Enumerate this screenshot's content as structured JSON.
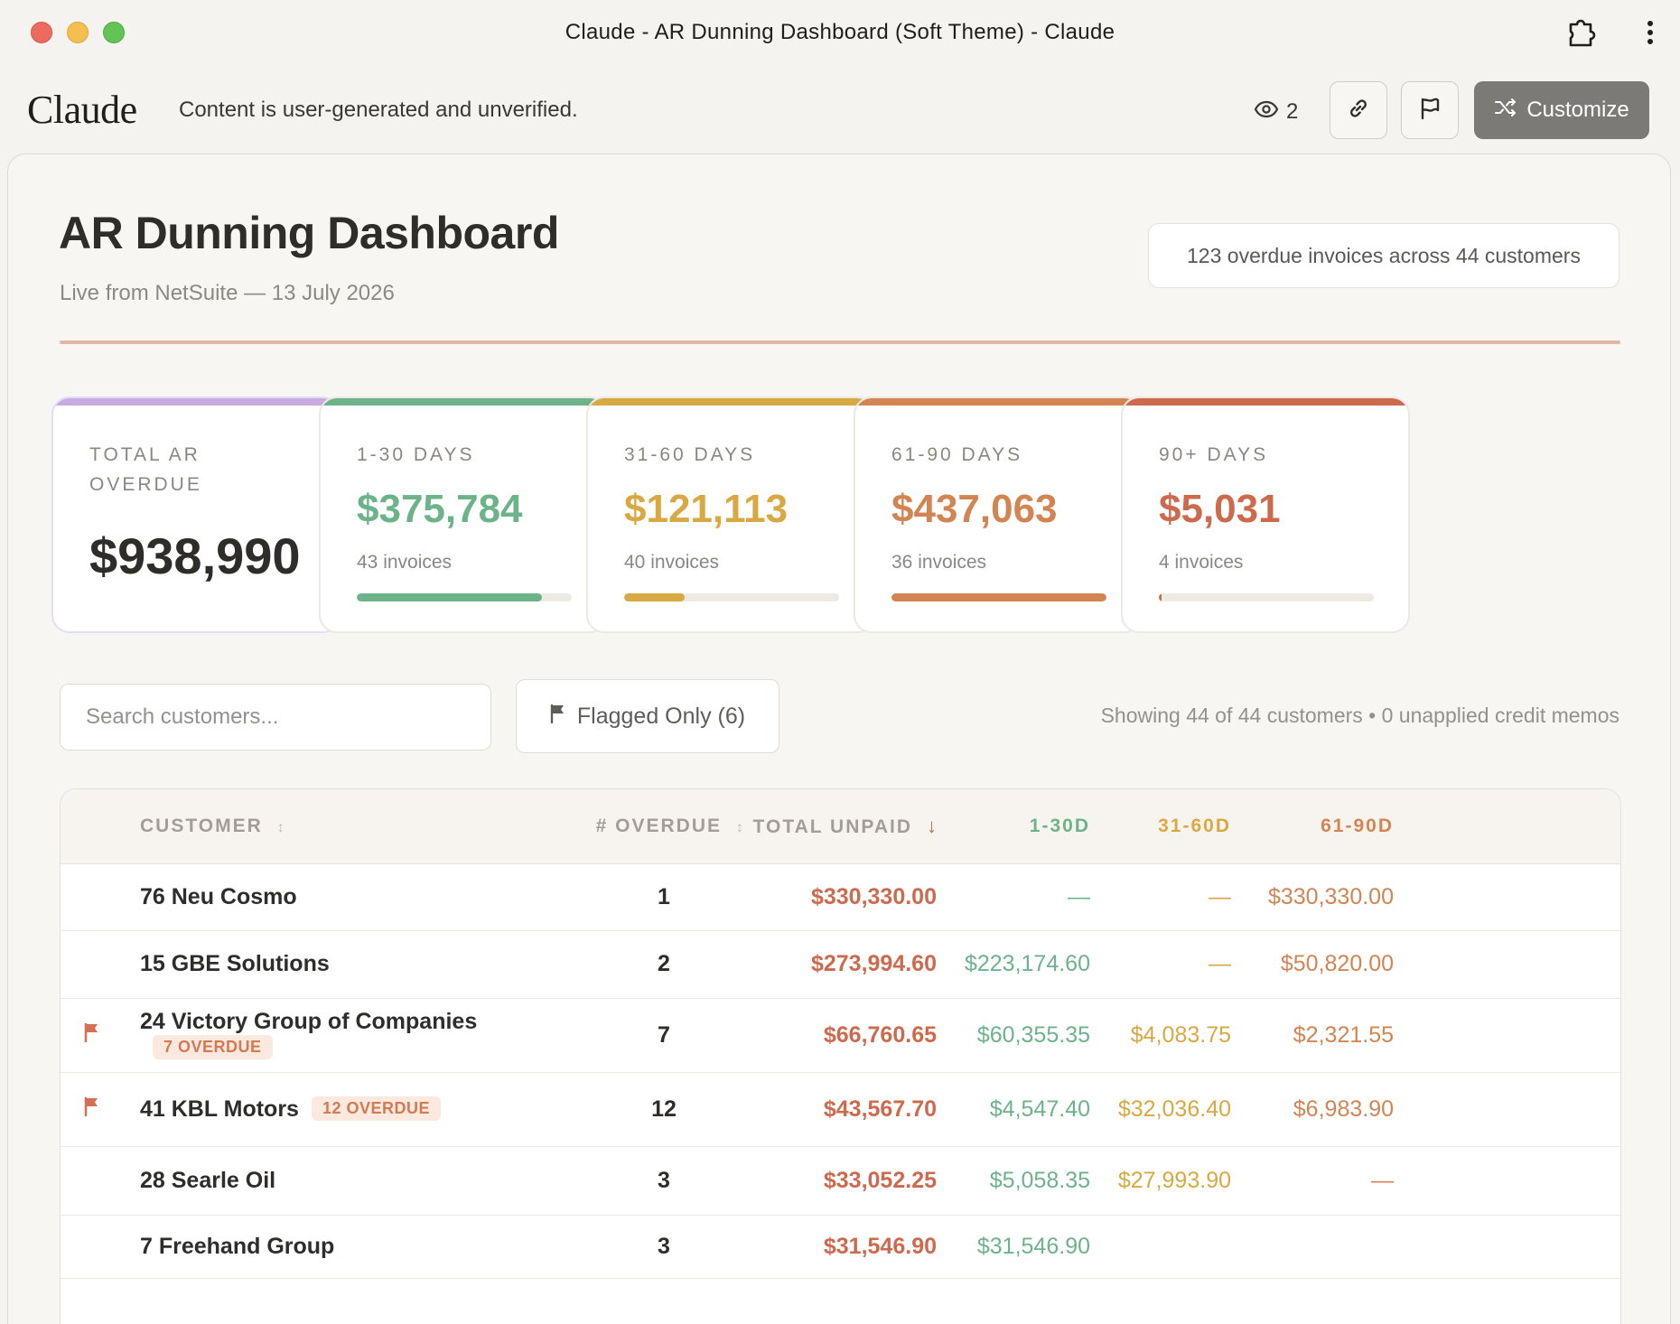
{
  "window": {
    "title": "Claude - AR Dunning Dashboard (Soft Theme) - Claude"
  },
  "app_header": {
    "brand": "Claude",
    "disclaimer": "Content is user-generated and unverified.",
    "view_count": "2",
    "customize_label": "Customize"
  },
  "dashboard": {
    "title": "AR Dunning Dashboard",
    "subtitle": "Live from NetSuite — 13 July 2026",
    "summary": "123 overdue invoices across 44 customers"
  },
  "cards": [
    {
      "label": "TOTAL AR OVERDUE",
      "value": "$938,990",
      "accent": "#c8a9e0"
    },
    {
      "label": "1-30 DAYS",
      "value": "$375,784",
      "count": "43 invoices",
      "accent": "#6db38a",
      "fill": 0.86
    },
    {
      "label": "31-60 DAYS",
      "value": "$121,113",
      "count": "40 invoices",
      "accent": "#d8a842",
      "fill": 0.28
    },
    {
      "label": "61-90 DAYS",
      "value": "$437,063",
      "count": "36 invoices",
      "accent": "#d28452",
      "fill": 1.0
    },
    {
      "label": "90+ DAYS",
      "value": "$5,031",
      "count": "4 invoices",
      "accent": "#cd6a4e",
      "fill": 0.012
    }
  ],
  "toolbar": {
    "search_placeholder": "Search customers...",
    "flagged_label": "Flagged Only (6)",
    "showing_text": "Showing 44 of 44 customers • 0 unapplied credit memos"
  },
  "table": {
    "headers": {
      "customer": "CUSTOMER",
      "overdue": "# OVERDUE",
      "total_unpaid": "TOTAL UNPAID",
      "d1_30": "1-30D",
      "d31_60": "31-60D",
      "d61_90": "61-90D"
    },
    "sort_icons": {
      "inactive": "↕",
      "active_desc": "↓"
    },
    "rows": [
      {
        "flagged": false,
        "customer": "76 Neu Cosmo",
        "badge": "",
        "overdue": "1",
        "total_unpaid": "$330,330.00",
        "d1_30": "—",
        "d31_60": "—",
        "d61_90": "$330,330.00"
      },
      {
        "flagged": false,
        "customer": "15 GBE Solutions",
        "badge": "",
        "overdue": "2",
        "total_unpaid": "$273,994.60",
        "d1_30": "$223,174.60",
        "d31_60": "—",
        "d61_90": "$50,820.00"
      },
      {
        "flagged": true,
        "customer": "24 Victory Group of Companies",
        "badge": "7 OVERDUE",
        "overdue": "7",
        "total_unpaid": "$66,760.65",
        "d1_30": "$60,355.35",
        "d31_60": "$4,083.75",
        "d61_90": "$2,321.55"
      },
      {
        "flagged": true,
        "customer": "41 KBL Motors",
        "badge": "12 OVERDUE",
        "overdue": "12",
        "total_unpaid": "$43,567.70",
        "d1_30": "$4,547.40",
        "d31_60": "$32,036.40",
        "d61_90": "$6,983.90"
      },
      {
        "flagged": false,
        "customer": "28 Searle Oil",
        "badge": "",
        "overdue": "3",
        "total_unpaid": "$33,052.25",
        "d1_30": "$5,058.35",
        "d31_60": "$27,993.90",
        "d61_90": "—"
      },
      {
        "flagged": false,
        "customer": "7 Freehand Group",
        "badge": "",
        "overdue": "3",
        "total_unpaid": "$31,546.90",
        "d1_30": "$31,546.90",
        "d31_60": "",
        "d61_90": ""
      }
    ]
  }
}
